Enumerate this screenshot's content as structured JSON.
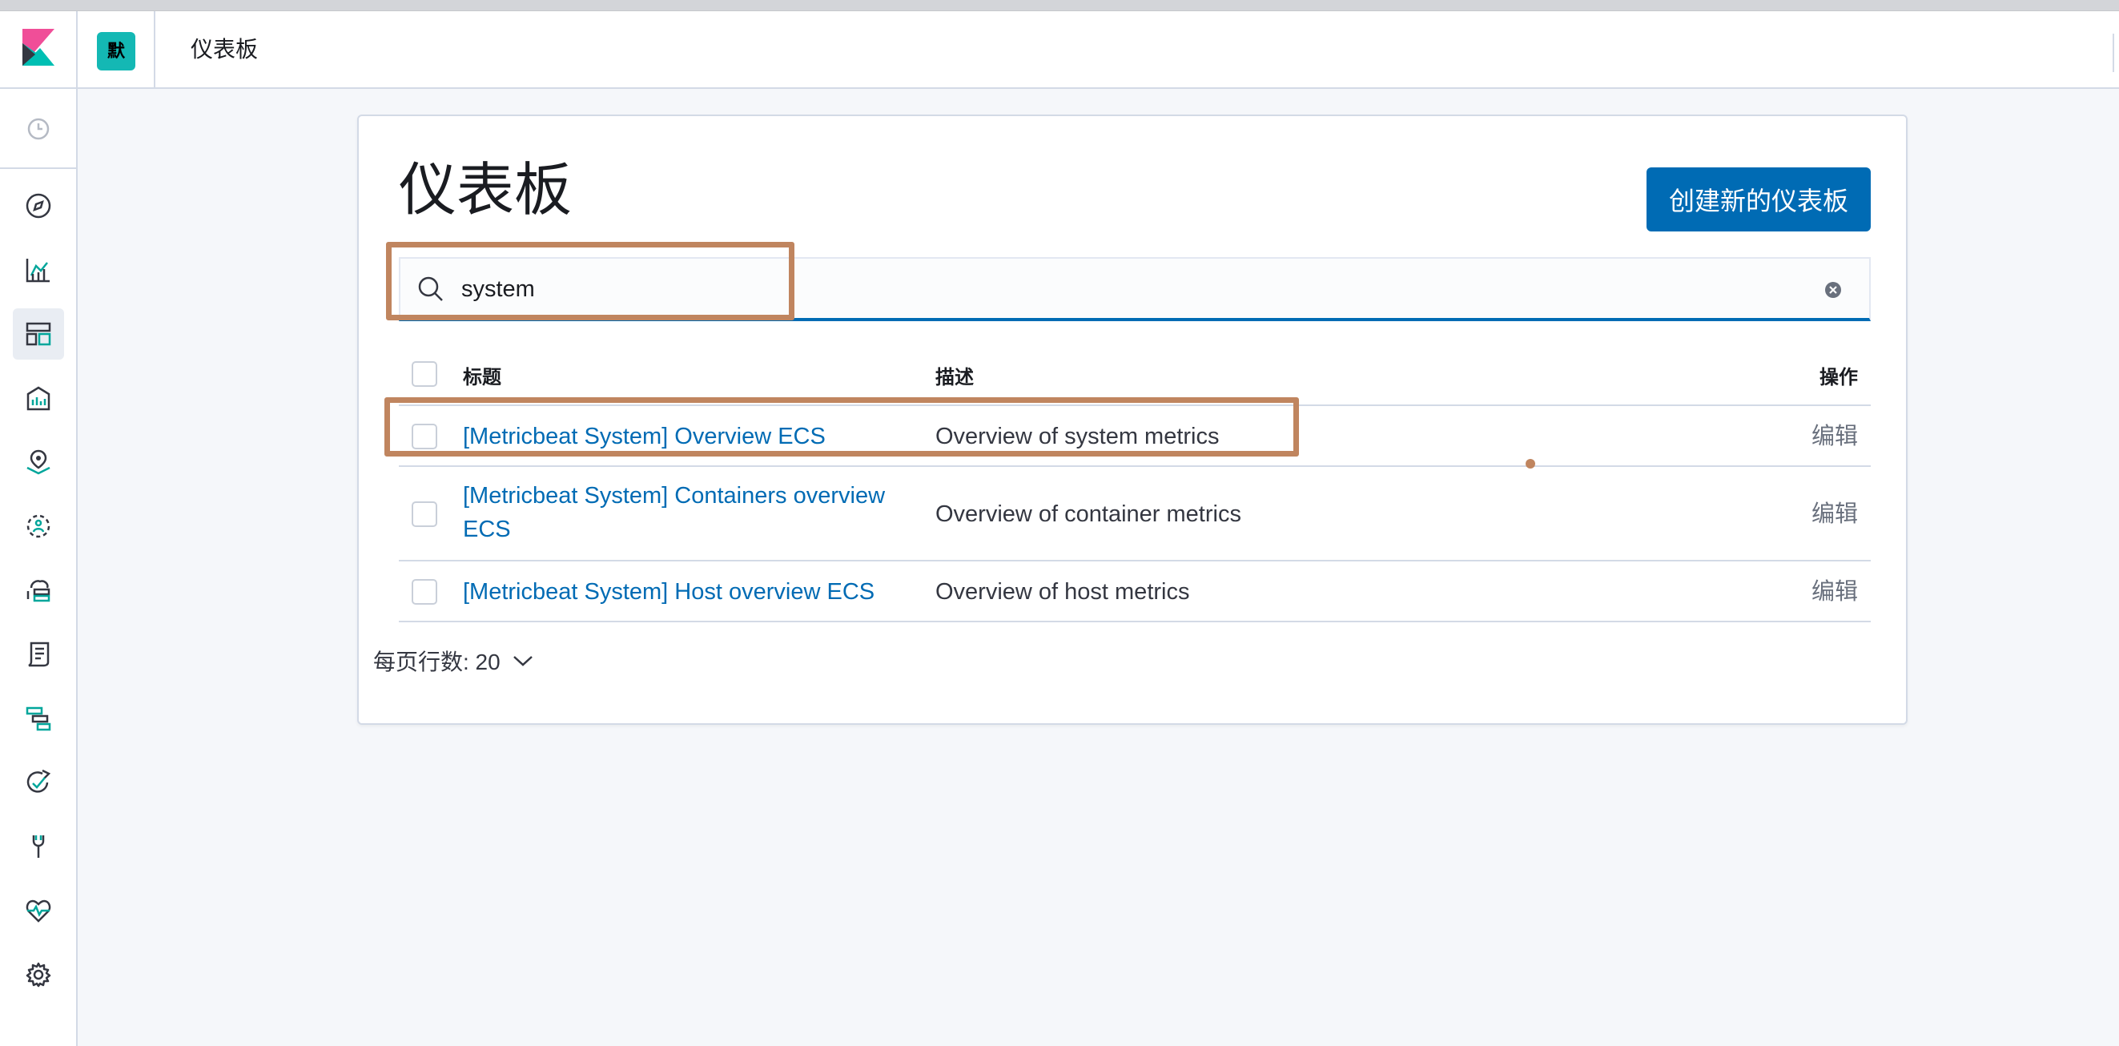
{
  "header": {
    "space_badge": "默",
    "breadcrumb": "仪表板"
  },
  "sidebar": {
    "items": [
      {
        "icon": "clock-icon",
        "label": "recently-viewed"
      },
      {
        "icon": "compass-icon",
        "label": "discover"
      },
      {
        "icon": "visualize-icon",
        "label": "visualize"
      },
      {
        "icon": "dashboard-icon",
        "label": "dashboard",
        "active": true
      },
      {
        "icon": "canvas-icon",
        "label": "canvas"
      },
      {
        "icon": "maps-icon",
        "label": "maps"
      },
      {
        "icon": "ml-icon",
        "label": "machine-learning"
      },
      {
        "icon": "infrastructure-icon",
        "label": "infrastructure"
      },
      {
        "icon": "logs-icon",
        "label": "logs"
      },
      {
        "icon": "apm-icon",
        "label": "apm"
      },
      {
        "icon": "uptime-icon",
        "label": "uptime"
      },
      {
        "icon": "devtools-icon",
        "label": "dev-tools"
      },
      {
        "icon": "monitoring-icon",
        "label": "monitoring"
      },
      {
        "icon": "gear-icon",
        "label": "management"
      }
    ]
  },
  "main": {
    "title": "仪表板",
    "create_button": "创建新的仪表板",
    "search": {
      "value": "system",
      "placeholder": ""
    },
    "table": {
      "headers": {
        "title": "标题",
        "description": "描述",
        "actions": "操作"
      },
      "rows": [
        {
          "title": "[Metricbeat System] Overview ECS",
          "description": "Overview of system metrics",
          "action": "编辑"
        },
        {
          "title_line1": "[Metricbeat System] Containers overview",
          "title_line2": "ECS",
          "description": "Overview of container metrics",
          "action": "编辑"
        },
        {
          "title": "[Metricbeat System] Host overview ECS",
          "description": "Overview of host metrics",
          "action": "编辑"
        }
      ]
    },
    "pager": {
      "label": "每页行数: 20"
    }
  },
  "colors": {
    "accent": "#006bb4",
    "badge": "#14b8b4",
    "annotation": "#c0855f"
  }
}
